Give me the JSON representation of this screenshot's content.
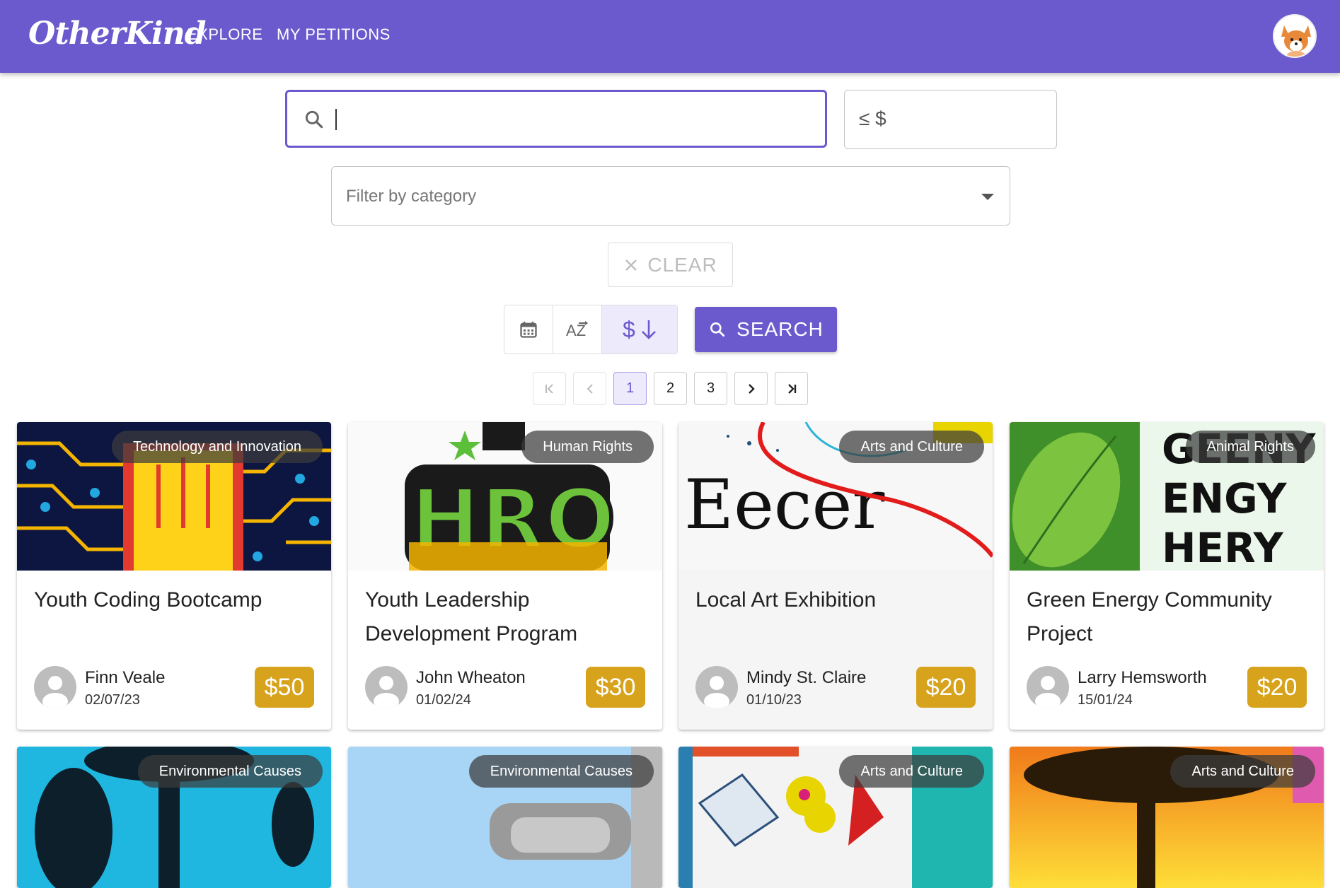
{
  "header": {
    "logo": "OtherKind",
    "nav": [
      "EXPLORE",
      "MY PETITIONS"
    ]
  },
  "search": {
    "value": "",
    "placeholder": ""
  },
  "price_filter": {
    "adornment": "≤ $",
    "value": ""
  },
  "category_filter": {
    "placeholder": "Filter by category"
  },
  "clear_button": {
    "label": "CLEAR"
  },
  "sort": {
    "options": [
      "date",
      "alphabetical",
      "cost"
    ],
    "active": "cost",
    "az_label": "AZ",
    "cost_label": "$"
  },
  "search_button": {
    "label": "SEARCH"
  },
  "pagination": {
    "pages": [
      "1",
      "2",
      "3"
    ],
    "current": "1"
  },
  "petitions": [
    {
      "title": "Youth Coding Bootcamp",
      "category": "Technology and Innovation",
      "owner": "Finn Veale",
      "date": "02/07/23",
      "price": "$50"
    },
    {
      "title": "Youth Leadership Development Program",
      "category": "Human Rights",
      "owner": "John Wheaton",
      "date": "01/02/24",
      "price": "$30"
    },
    {
      "title": "Local Art Exhibition",
      "category": "Arts and Culture",
      "owner": "Mindy St. Claire",
      "date": "01/10/23",
      "price": "$20"
    },
    {
      "title": "Green Energy Community Project",
      "category": "Animal Rights",
      "owner": "Larry Hemsworth",
      "date": "15/01/24",
      "price": "$20"
    },
    {
      "title": "",
      "category": "Environmental Causes",
      "owner": "",
      "date": "",
      "price": ""
    },
    {
      "title": "",
      "category": "Environmental Causes",
      "owner": "",
      "date": "",
      "price": ""
    },
    {
      "title": "",
      "category": "Arts and Culture",
      "owner": "",
      "date": "",
      "price": ""
    },
    {
      "title": "",
      "category": "Arts and Culture",
      "owner": "",
      "date": "",
      "price": ""
    }
  ],
  "image_text": {
    "hro": "HRO",
    "art": "Eecer",
    "green": [
      "GEENY",
      "ENGY",
      "HERY"
    ]
  },
  "colors": {
    "primary": "#6a5acd",
    "price_badge": "#d8a31c"
  }
}
